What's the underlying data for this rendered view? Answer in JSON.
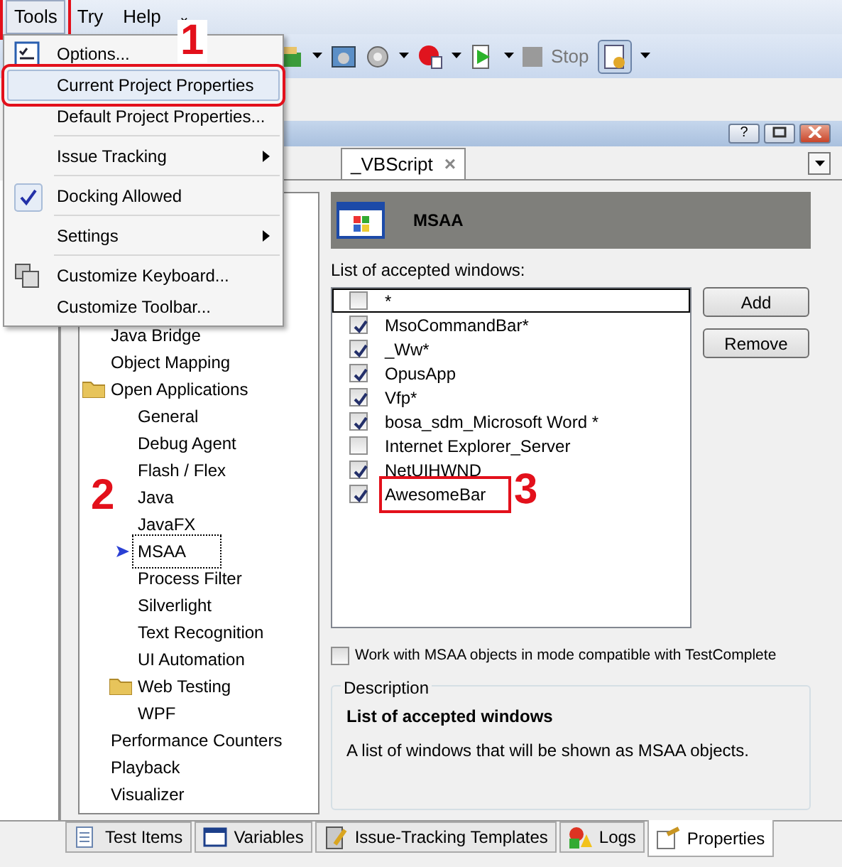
{
  "menubar": [
    {
      "label": "Tools",
      "open": true,
      "highlighted": true
    },
    {
      "label": "Try",
      "open": false,
      "highlighted": false
    },
    {
      "label": "Help",
      "open": false,
      "highlighted": false
    }
  ],
  "menubar_caret": "⌄",
  "toolbar": {
    "stop_label": "Stop"
  },
  "panel_header": {
    "help_button": "?"
  },
  "document_tabs": [
    {
      "label": "_VBScript",
      "close": "×"
    }
  ],
  "tools_menu": [
    {
      "kind": "checklist-item",
      "label": "Options...",
      "selected": false,
      "checked": false,
      "submenu": false,
      "highlighted": false
    },
    {
      "kind": "item",
      "label": "Current Project Properties",
      "selected": true,
      "checked": false,
      "submenu": false,
      "highlighted": true
    },
    {
      "kind": "item",
      "label": "Default Project Properties...",
      "selected": false,
      "checked": false,
      "submenu": false,
      "highlighted": false
    },
    {
      "kind": "separator"
    },
    {
      "kind": "item",
      "label": "Issue Tracking",
      "selected": false,
      "checked": false,
      "submenu": true,
      "highlighted": false
    },
    {
      "kind": "separator"
    },
    {
      "kind": "item",
      "label": "Docking Allowed",
      "selected": false,
      "checked": true,
      "submenu": false,
      "highlighted": false
    },
    {
      "kind": "separator"
    },
    {
      "kind": "item",
      "label": "Settings",
      "selected": false,
      "checked": false,
      "submenu": true,
      "highlighted": false
    },
    {
      "kind": "separator"
    },
    {
      "kind": "keyboard-item",
      "label": "Customize Keyboard...",
      "selected": false,
      "checked": false,
      "submenu": false,
      "highlighted": false
    },
    {
      "kind": "item",
      "label": "Customize Toolbar...",
      "selected": false,
      "checked": false,
      "submenu": false,
      "highlighted": false
    }
  ],
  "tree": [
    {
      "label": "Java Bridge",
      "kind": "leaf",
      "selected": false,
      "highlighted": false
    },
    {
      "label": "Object Mapping",
      "kind": "leaf",
      "selected": false,
      "highlighted": false
    },
    {
      "label": "Open Applications",
      "kind": "folder",
      "selected": false,
      "highlighted": false,
      "children": [
        {
          "label": "General",
          "kind": "leaf",
          "selected": false,
          "highlighted": false
        },
        {
          "label": "Debug Agent",
          "kind": "leaf",
          "selected": false,
          "highlighted": false
        },
        {
          "label": "Flash / Flex",
          "kind": "leaf",
          "selected": false,
          "highlighted": false
        },
        {
          "label": "Java",
          "kind": "leaf",
          "selected": false,
          "highlighted": false
        },
        {
          "label": "JavaFX",
          "kind": "leaf",
          "selected": false,
          "highlighted": false
        },
        {
          "label": "MSAA",
          "kind": "leaf",
          "selected": true,
          "highlighted": true
        },
        {
          "label": "Process Filter",
          "kind": "leaf",
          "selected": false,
          "highlighted": false
        },
        {
          "label": "Silverlight",
          "kind": "leaf",
          "selected": false,
          "highlighted": false
        },
        {
          "label": "Text Recognition",
          "kind": "leaf",
          "selected": false,
          "highlighted": false
        },
        {
          "label": "UI Automation",
          "kind": "leaf",
          "selected": false,
          "highlighted": false
        },
        {
          "label": "Web Testing",
          "kind": "folder",
          "selected": false,
          "highlighted": false
        },
        {
          "label": "WPF",
          "kind": "leaf",
          "selected": false,
          "highlighted": false
        }
      ]
    },
    {
      "label": "Performance Counters",
      "kind": "leaf",
      "selected": false,
      "highlighted": false
    },
    {
      "label": "Playback",
      "kind": "leaf",
      "selected": false,
      "highlighted": false
    },
    {
      "label": "Visualizer",
      "kind": "leaf",
      "selected": false,
      "highlighted": false
    }
  ],
  "properties": {
    "title": "MSAA",
    "list_label": "List of accepted windows:",
    "windows": [
      {
        "name": "*",
        "checked": false,
        "selected": true,
        "highlighted": false
      },
      {
        "name": "MsoCommandBar*",
        "checked": true,
        "selected": false,
        "highlighted": false
      },
      {
        "name": "_Ww*",
        "checked": true,
        "selected": false,
        "highlighted": false
      },
      {
        "name": "OpusApp",
        "checked": true,
        "selected": false,
        "highlighted": false
      },
      {
        "name": "Vfp*",
        "checked": true,
        "selected": false,
        "highlighted": false
      },
      {
        "name": "bosa_sdm_Microsoft Word *",
        "checked": true,
        "selected": false,
        "highlighted": false
      },
      {
        "name": "Internet Explorer_Server",
        "checked": false,
        "selected": false,
        "highlighted": false
      },
      {
        "name": "NetUIHWND",
        "checked": true,
        "selected": false,
        "highlighted": false
      },
      {
        "name": "AwesomeBar",
        "checked": true,
        "selected": false,
        "highlighted": true
      }
    ],
    "buttons": [
      "Add",
      "Remove"
    ],
    "compat_option": {
      "label": "Work with MSAA objects in mode compatible with TestComplete",
      "checked": false
    },
    "description": {
      "legend": "Description",
      "heading": "List of accepted windows",
      "text": "A list of windows that will be shown as MSAA objects."
    }
  },
  "bottom_tabs": [
    {
      "label": "Test Items",
      "selected": false
    },
    {
      "label": "Variables",
      "selected": false
    },
    {
      "label": "Issue-Tracking Templates",
      "selected": false
    },
    {
      "label": "Logs",
      "selected": false
    },
    {
      "label": "Properties",
      "selected": true
    }
  ],
  "callouts": [
    {
      "label": "1"
    },
    {
      "label": "2"
    },
    {
      "label": "3"
    }
  ]
}
